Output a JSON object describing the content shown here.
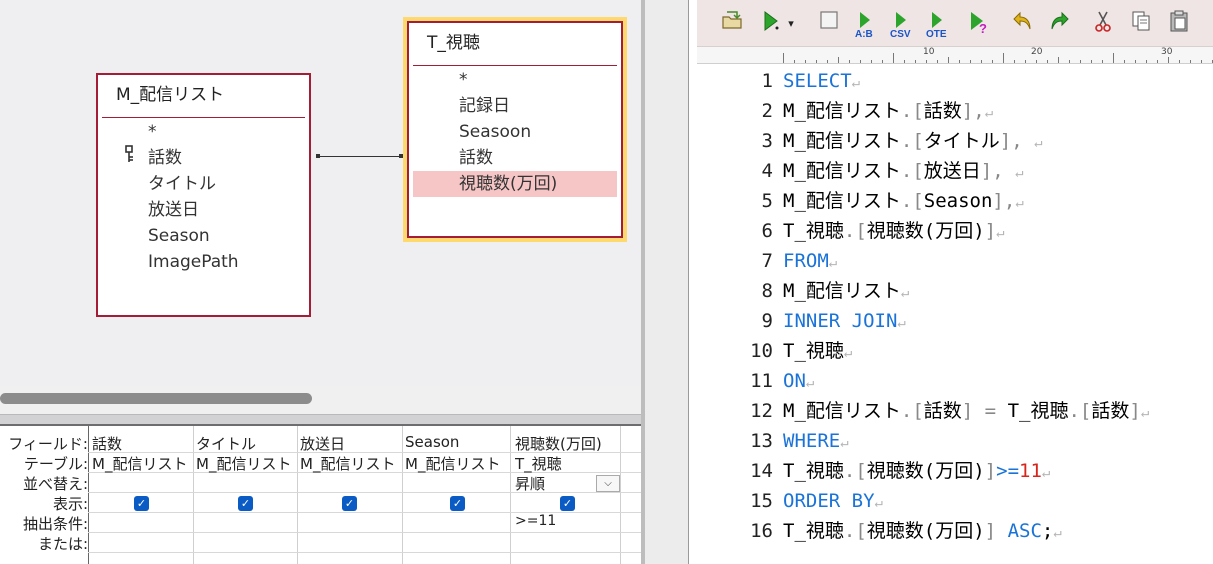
{
  "designer": {
    "table_m": {
      "title": "M_配信リスト",
      "fields": [
        "*",
        "話数",
        "タイトル",
        "放送日",
        "Season",
        "ImagePath"
      ]
    },
    "table_t": {
      "title": "T_視聴",
      "fields": [
        "*",
        "記録日",
        "Seasoon",
        "話数",
        "視聴数(万回)"
      ]
    },
    "grid": {
      "row_labels": [
        "フィールド:",
        "テーブル:",
        "並べ替え:",
        "表示:",
        "抽出条件:",
        "または:"
      ],
      "columns": [
        {
          "field": "話数",
          "table": "M_配信リスト",
          "sort": "",
          "show": "✓",
          "criteria": ""
        },
        {
          "field": "タイトル",
          "table": "M_配信リスト",
          "sort": "",
          "show": "✓",
          "criteria": ""
        },
        {
          "field": "放送日",
          "table": "M_配信リスト",
          "sort": "",
          "show": "✓",
          "criteria": ""
        },
        {
          "field": "Season",
          "table": "M_配信リスト",
          "sort": "",
          "show": "✓",
          "criteria": ""
        },
        {
          "field": "視聴数(万回)",
          "table": "T_視聴",
          "sort": "昇順",
          "show": "✓",
          "criteria": ">=11"
        }
      ],
      "dropdown_glyph": "⌵"
    }
  },
  "toolbar": {
    "icons": [
      "open-folder-icon",
      "run-icon",
      "stop-icon",
      "ab-icon",
      "csv-icon",
      "ote-icon",
      "help-icon",
      "undo-icon",
      "redo-icon",
      "cut-icon",
      "copy-icon",
      "paste-icon"
    ],
    "labels": {
      "ab": "A:B",
      "csv": "CSV",
      "ote": "OTE",
      "run_arrow": "▾"
    }
  },
  "ruler": {
    "labels": [
      "10",
      "20",
      "30"
    ]
  },
  "editor": {
    "return_glyph": "↵",
    "lines": [
      {
        "n": "1",
        "parts": [
          {
            "t": "SELECT",
            "c": "kw"
          }
        ]
      },
      {
        "n": "2",
        "parts": [
          {
            "t": "M_配信リスト",
            "c": ""
          },
          {
            "t": ".[",
            "c": "pn"
          },
          {
            "t": "話数",
            "c": ""
          },
          {
            "t": "],",
            "c": "pn"
          }
        ]
      },
      {
        "n": "3",
        "parts": [
          {
            "t": "M_配信リスト",
            "c": ""
          },
          {
            "t": ".[",
            "c": "pn"
          },
          {
            "t": "タイトル",
            "c": ""
          },
          {
            "t": "], ",
            "c": "pn"
          }
        ]
      },
      {
        "n": "4",
        "parts": [
          {
            "t": "M_配信リスト",
            "c": ""
          },
          {
            "t": ".[",
            "c": "pn"
          },
          {
            "t": "放送日",
            "c": ""
          },
          {
            "t": "], ",
            "c": "pn"
          }
        ]
      },
      {
        "n": "5",
        "parts": [
          {
            "t": "M_配信リスト",
            "c": ""
          },
          {
            "t": ".[",
            "c": "pn"
          },
          {
            "t": "Season",
            "c": ""
          },
          {
            "t": "],",
            "c": "pn"
          }
        ]
      },
      {
        "n": "6",
        "parts": [
          {
            "t": "T_視聴",
            "c": ""
          },
          {
            "t": ".[",
            "c": "pn"
          },
          {
            "t": "視聴数(万回)",
            "c": ""
          },
          {
            "t": "]",
            "c": "pn"
          }
        ]
      },
      {
        "n": "7",
        "parts": [
          {
            "t": "FROM",
            "c": "kw"
          }
        ]
      },
      {
        "n": "8",
        "parts": [
          {
            "t": "M_配信リスト",
            "c": ""
          }
        ]
      },
      {
        "n": "9",
        "parts": [
          {
            "t": "INNER JOIN",
            "c": "kw"
          }
        ]
      },
      {
        "n": "10",
        "parts": [
          {
            "t": "T_視聴",
            "c": ""
          }
        ]
      },
      {
        "n": "11",
        "parts": [
          {
            "t": "ON",
            "c": "kw"
          }
        ]
      },
      {
        "n": "12",
        "parts": [
          {
            "t": "M_配信リスト",
            "c": ""
          },
          {
            "t": ".[",
            "c": "pn"
          },
          {
            "t": "話数",
            "c": ""
          },
          {
            "t": "] = ",
            "c": "pn"
          },
          {
            "t": "T_視聴",
            "c": ""
          },
          {
            "t": ".[",
            "c": "pn"
          },
          {
            "t": "話数",
            "c": ""
          },
          {
            "t": "]",
            "c": "pn"
          }
        ]
      },
      {
        "n": "13",
        "parts": [
          {
            "t": "WHERE",
            "c": "kw"
          }
        ]
      },
      {
        "n": "14",
        "parts": [
          {
            "t": "T_視聴",
            "c": ""
          },
          {
            "t": ".[",
            "c": "pn"
          },
          {
            "t": "視聴数(万回)",
            "c": ""
          },
          {
            "t": "]",
            "c": "pn"
          },
          {
            "t": ">=",
            "c": "kw"
          },
          {
            "t": "11",
            "c": "nm"
          }
        ]
      },
      {
        "n": "15",
        "parts": [
          {
            "t": "ORDER BY",
            "c": "kw"
          }
        ]
      },
      {
        "n": "16",
        "parts": [
          {
            "t": "T_視聴",
            "c": ""
          },
          {
            "t": ".[",
            "c": "pn"
          },
          {
            "t": "視聴数(万回)",
            "c": ""
          },
          {
            "t": "] ",
            "c": "pn"
          },
          {
            "t": "ASC",
            "c": "kw"
          },
          {
            "t": ";",
            "c": ""
          }
        ]
      }
    ]
  }
}
